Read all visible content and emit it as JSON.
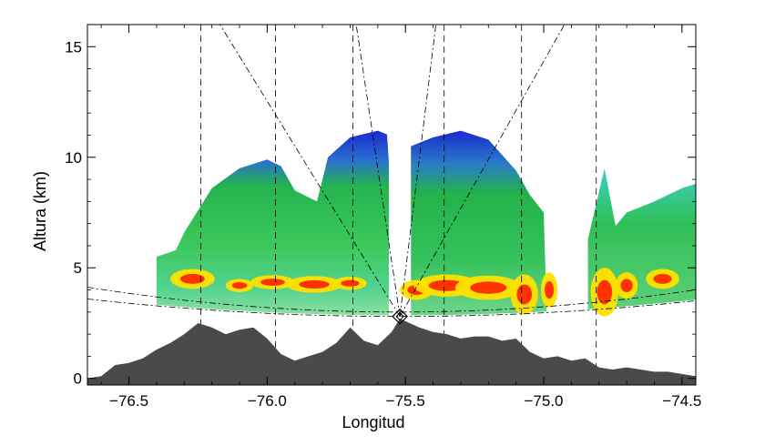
{
  "chart_data": {
    "type": "heatmap",
    "title": "",
    "xlabel": "Longitud",
    "ylabel": "Altura (km)",
    "xlim": [
      -76.65,
      -74.45
    ],
    "ylim": [
      -0.3,
      16
    ],
    "x_ticks": [
      -76.5,
      -76.0,
      -75.5,
      -75.0,
      -74.5
    ],
    "x_tick_labels": [
      "−76.5",
      "−76.0",
      "−75.5",
      "−75.0",
      "−74.5"
    ],
    "y_ticks": [
      0,
      5,
      10,
      15
    ],
    "y_tick_labels": [
      "0",
      "5",
      "10",
      "15"
    ],
    "radar_site": {
      "lon": -75.52,
      "alt_km": 2.8
    },
    "terrain_profile": [
      [
        -76.65,
        0
      ],
      [
        -76.6,
        0.1
      ],
      [
        -76.55,
        0.6
      ],
      [
        -76.5,
        0.7
      ],
      [
        -76.45,
        0.9
      ],
      [
        -76.4,
        1.3
      ],
      [
        -76.35,
        1.6
      ],
      [
        -76.3,
        2.0
      ],
      [
        -76.25,
        2.5
      ],
      [
        -76.2,
        2.3
      ],
      [
        -76.15,
        2.0
      ],
      [
        -76.1,
        2.2
      ],
      [
        -76.05,
        2.3
      ],
      [
        -76.0,
        1.8
      ],
      [
        -75.95,
        1.1
      ],
      [
        -75.9,
        0.8
      ],
      [
        -75.85,
        1.0
      ],
      [
        -75.8,
        1.2
      ],
      [
        -75.75,
        1.6
      ],
      [
        -75.7,
        2.3
      ],
      [
        -75.65,
        1.7
      ],
      [
        -75.6,
        1.5
      ],
      [
        -75.55,
        2.1
      ],
      [
        -75.52,
        2.7
      ],
      [
        -75.45,
        2.3
      ],
      [
        -75.4,
        2.1
      ],
      [
        -75.35,
        2.0
      ],
      [
        -75.3,
        1.8
      ],
      [
        -75.25,
        1.9
      ],
      [
        -75.2,
        1.9
      ],
      [
        -75.15,
        1.7
      ],
      [
        -75.1,
        1.8
      ],
      [
        -75.05,
        1.2
      ],
      [
        -75.0,
        0.9
      ],
      [
        -74.95,
        1.0
      ],
      [
        -74.9,
        0.8
      ],
      [
        -74.85,
        0.9
      ],
      [
        -74.8,
        0.5
      ],
      [
        -74.75,
        0.4
      ],
      [
        -74.7,
        0.5
      ],
      [
        -74.65,
        0.4
      ],
      [
        -74.6,
        0.3
      ],
      [
        -74.55,
        0.3
      ],
      [
        -74.5,
        0.2
      ],
      [
        -74.45,
        0.1
      ]
    ],
    "reflectivity_top_west": [
      [
        -76.4,
        5.5
      ],
      [
        -76.33,
        5.8
      ],
      [
        -76.3,
        6.6
      ],
      [
        -76.25,
        7.6
      ],
      [
        -76.2,
        8.6
      ],
      [
        -76.1,
        9.5
      ],
      [
        -76.0,
        9.9
      ],
      [
        -75.95,
        9.6
      ],
      [
        -75.9,
        8.5
      ],
      [
        -75.82,
        8.0
      ],
      [
        -75.78,
        10.0
      ],
      [
        -75.7,
        10.9
      ],
      [
        -75.6,
        11.2
      ],
      [
        -75.56,
        11.0
      ]
    ],
    "reflectivity_top_east": [
      [
        -75.48,
        10.5
      ],
      [
        -75.4,
        10.9
      ],
      [
        -75.3,
        11.2
      ],
      [
        -75.2,
        10.8
      ],
      [
        -75.1,
        9.4
      ],
      [
        -75.05,
        8.3
      ],
      [
        -75.0,
        7.5
      ],
      [
        -74.99,
        3.3
      ]
    ],
    "reflectivity_top_far_east": [
      [
        -74.84,
        6.3
      ],
      [
        -74.78,
        9.5
      ],
      [
        -74.74,
        6.9
      ],
      [
        -74.7,
        7.5
      ],
      [
        -74.6,
        8.0
      ],
      [
        -74.5,
        8.6
      ],
      [
        -74.45,
        8.8
      ]
    ],
    "colors": {
      "terrain": "#4a4a4a",
      "low": "#3dd0c3",
      "mid": "#22b34a",
      "high": "#1a2bd0",
      "strong": "#ffe000",
      "very_strong": "#ff2000"
    }
  }
}
